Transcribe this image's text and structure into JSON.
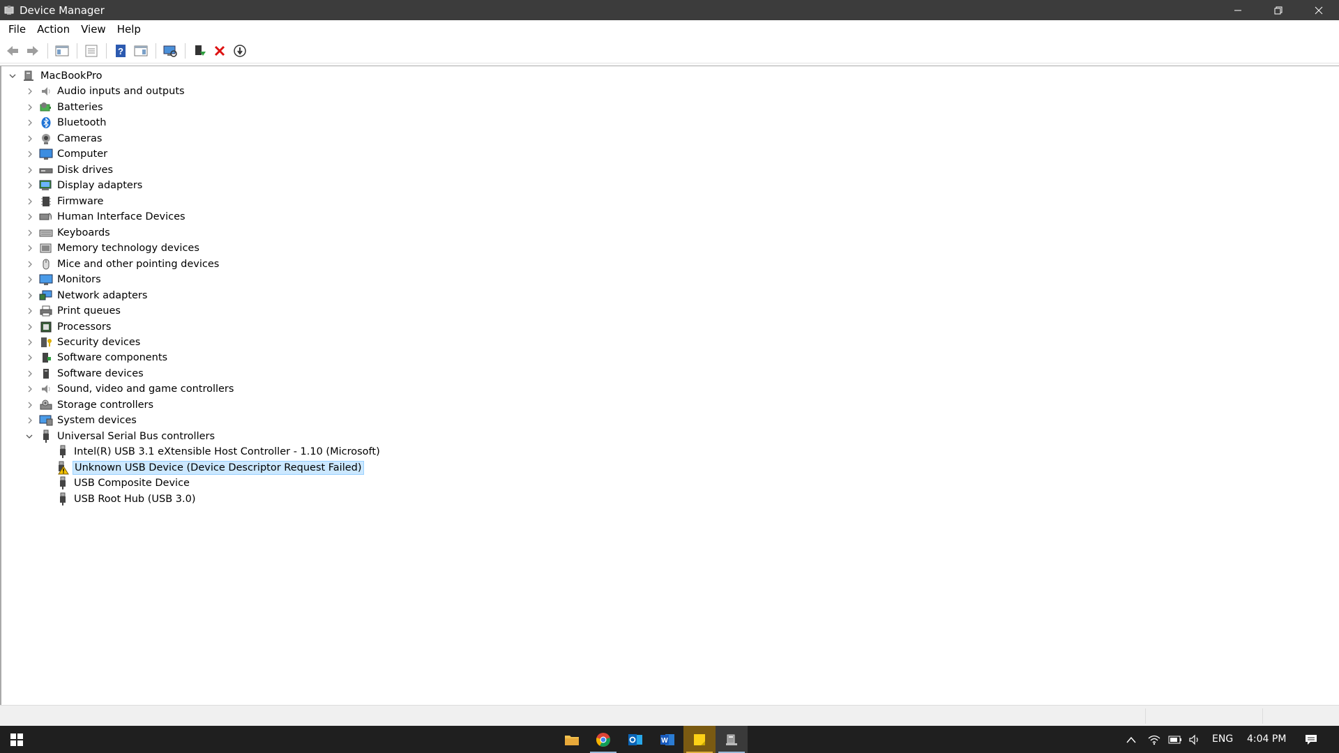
{
  "window": {
    "title": "Device Manager",
    "controls": {
      "minimize": "minimize",
      "restore": "restore",
      "close": "close"
    }
  },
  "menu": [
    "File",
    "Action",
    "View",
    "Help"
  ],
  "toolbar": {
    "buttons": [
      "back-icon",
      "forward-icon",
      "show-hide-tree-icon",
      "properties-icon",
      "help-icon",
      "action-pane-icon",
      "scan-hardware-icon",
      "update-driver-icon",
      "uninstall-device-icon",
      "disable-device-icon"
    ]
  },
  "tree": {
    "root": "MacBookPro",
    "categories": [
      "Audio inputs and outputs",
      "Batteries",
      "Bluetooth",
      "Cameras",
      "Computer",
      "Disk drives",
      "Display adapters",
      "Firmware",
      "Human Interface Devices",
      "Keyboards",
      "Memory technology devices",
      "Mice and other pointing devices",
      "Monitors",
      "Network adapters",
      "Print queues",
      "Processors",
      "Security devices",
      "Software components",
      "Software devices",
      "Sound, video and game controllers",
      "Storage controllers",
      "System devices"
    ],
    "expanded_category": "Universal Serial Bus controllers",
    "usb_devices": [
      "Intel(R) USB 3.1 eXtensible Host Controller - 1.10 (Microsoft)",
      "Unknown USB Device (Device Descriptor Request Failed)",
      "USB Composite Device",
      "USB Root Hub (USB 3.0)"
    ],
    "selected_device": "Unknown USB Device (Device Descriptor Request Failed)"
  },
  "taskbar": {
    "apps": [
      "file-explorer-icon",
      "chrome-icon",
      "outlook-icon",
      "word-icon",
      "sticky-notes-icon",
      "device-manager-icon"
    ],
    "tray": {
      "language": "ENG",
      "time": "4:04 PM"
    }
  },
  "colors": {
    "titlebar": "#3c3c3c",
    "selection": "#cce8ff",
    "taskbar": "#1f1f1f",
    "warning": "#f5c400"
  }
}
